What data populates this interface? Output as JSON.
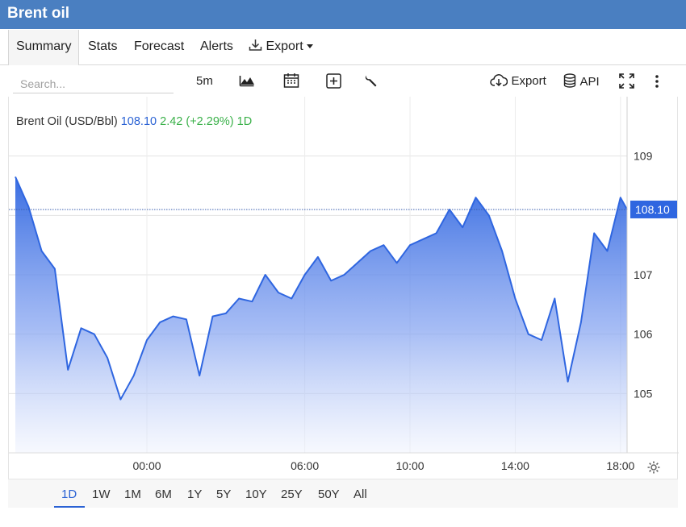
{
  "app": {
    "title": "Brent oil"
  },
  "tabs": [
    {
      "label": "Summary",
      "active": true
    },
    {
      "label": "Stats"
    },
    {
      "label": "Forecast"
    },
    {
      "label": "Alerts"
    },
    {
      "label": "Export"
    }
  ],
  "toolbar": {
    "search_placeholder": "Search...",
    "interval": "5m",
    "export_label": "Export",
    "api_label": "API",
    "icons": [
      "mountain-chart-icon",
      "calendar-icon",
      "add-indicator-icon",
      "wrench-icon",
      "cloud-download-icon",
      "database-icon",
      "fullscreen-icon",
      "more-vertical-icon",
      "download-icon",
      "settings-gear-icon"
    ]
  },
  "legend": {
    "symbol": "Brent Oil (USD/Bbl)",
    "price": "108.10",
    "change": "2.42 (+2.29%)",
    "period": "1D"
  },
  "ranges": [
    "1D",
    "1W",
    "1M",
    "6M",
    "1Y",
    "5Y",
    "10Y",
    "25Y",
    "50Y",
    "All"
  ],
  "active_range": "1D",
  "colors": {
    "titlebar": "#4a7fc1",
    "line": "#2f66e0",
    "accent": "#2a62d4",
    "positive": "#3bb14a",
    "price_tag": "#2f66e0"
  },
  "chart_data": {
    "type": "area",
    "series": [
      {
        "x": [
          "19:00",
          "19:30",
          "20:00",
          "20:30",
          "21:00",
          "21:30",
          "22:00",
          "22:30",
          "23:00",
          "23:30",
          "00:00",
          "00:30",
          "01:00",
          "01:30",
          "02:00",
          "02:30",
          "03:00",
          "03:30",
          "04:00",
          "04:30",
          "05:00",
          "05:30",
          "06:00",
          "06:30",
          "07:00",
          "07:30",
          "08:00",
          "08:30",
          "09:00",
          "09:30",
          "10:00",
          "10:30",
          "11:00",
          "11:30",
          "12:00",
          "12:30",
          "13:00",
          "13:30",
          "14:00",
          "14:30",
          "15:00",
          "15:30",
          "16:00",
          "16:30",
          "17:00",
          "17:30",
          "18:00",
          "18:15"
        ],
        "values": [
          108.65,
          108.15,
          107.4,
          107.1,
          105.4,
          106.1,
          106.0,
          105.6,
          104.9,
          105.3,
          105.9,
          106.2,
          106.3,
          106.25,
          105.3,
          106.3,
          106.35,
          106.6,
          106.55,
          107.0,
          106.7,
          106.6,
          107.0,
          107.3,
          106.9,
          107.0,
          107.2,
          107.4,
          107.5,
          107.2,
          107.5,
          107.6,
          107.7,
          108.1,
          107.8,
          108.3,
          108.0,
          107.4,
          106.6,
          106.0,
          105.9,
          106.6,
          105.2,
          106.2,
          107.7,
          107.4,
          108.3,
          108.1
        ]
      }
    ],
    "last_price": 108.1,
    "y_ticks": [
      105,
      106,
      107,
      109
    ],
    "x_ticks": [
      "00:00",
      "06:00",
      "10:00",
      "14:00",
      "18:00"
    ],
    "ylim": [
      104.0,
      110.0
    ],
    "grid": true
  }
}
